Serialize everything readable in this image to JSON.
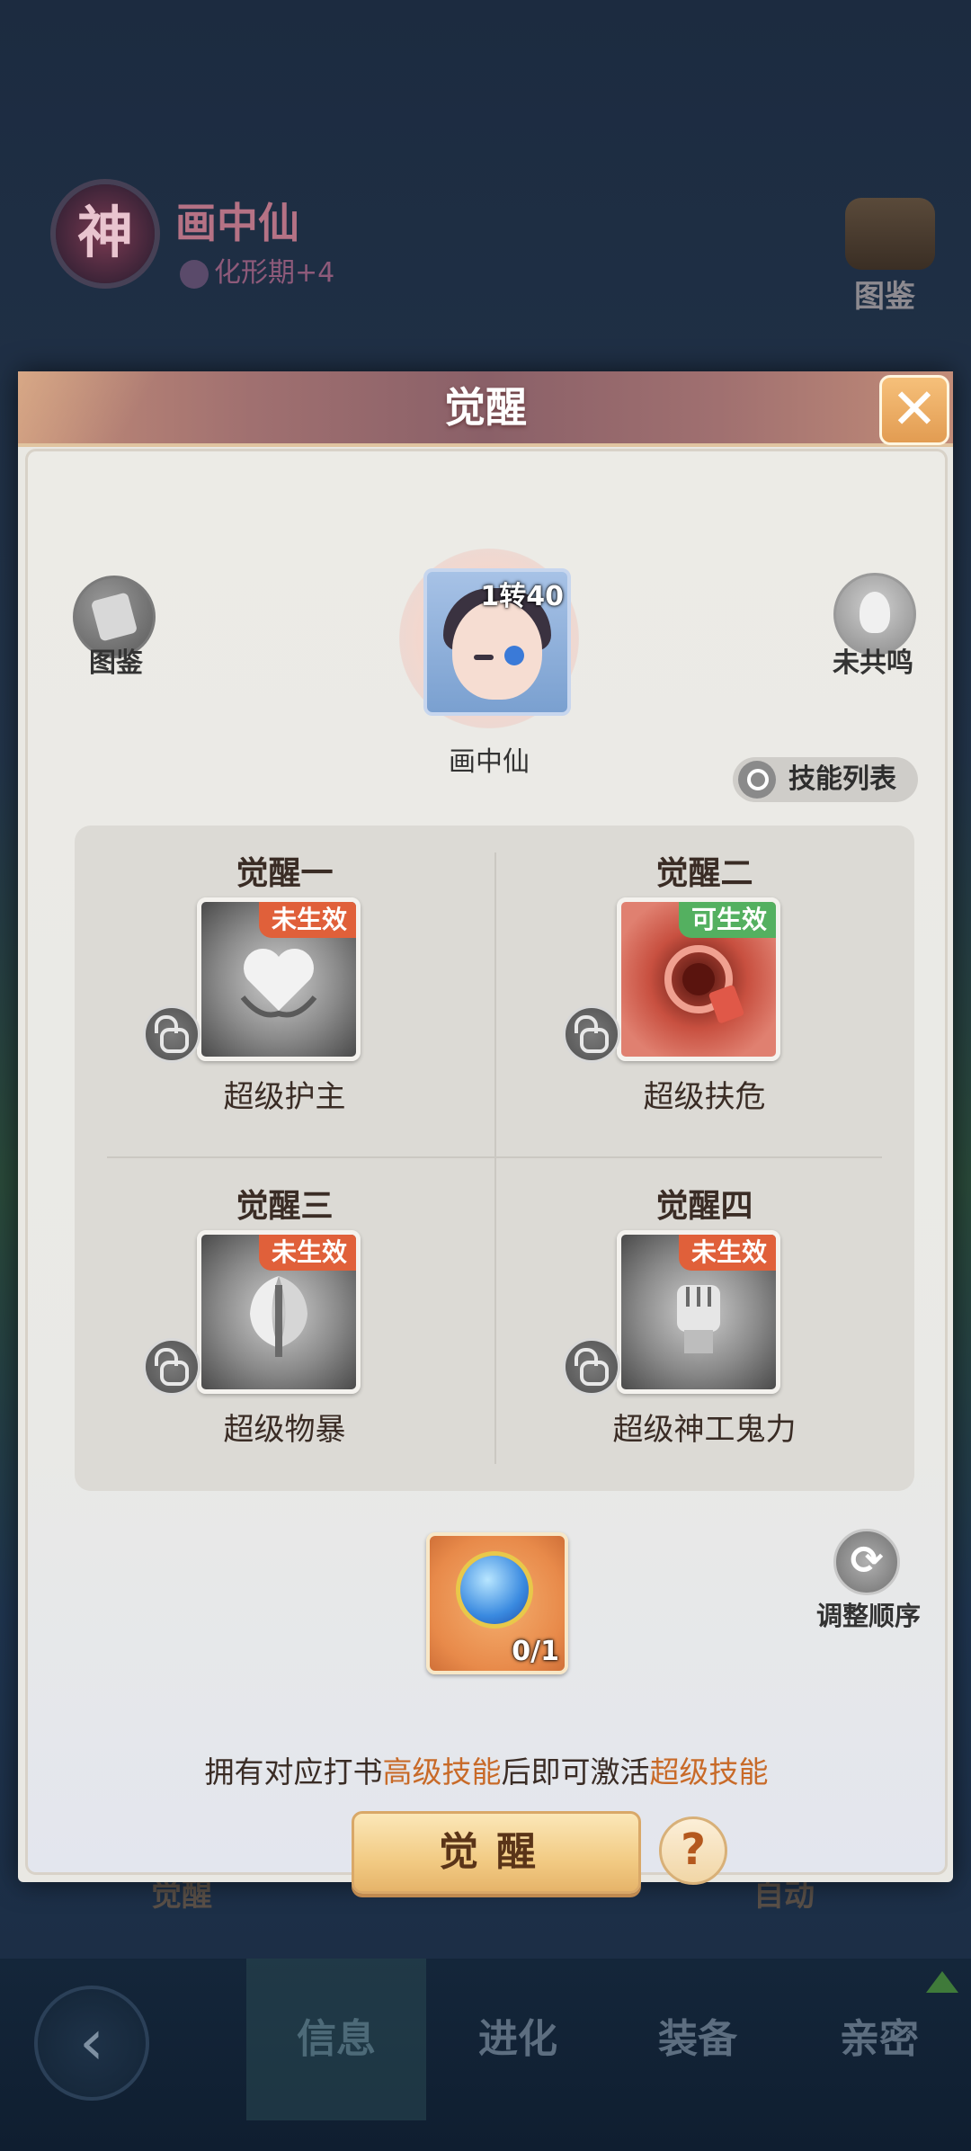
{
  "background": {
    "emblem_char": "神",
    "pet_name": "画中仙",
    "pet_stage": "化形期+4",
    "tujian_label": "图鉴",
    "bottom_label_left": "觉醒",
    "bottom_label_right": "自动"
  },
  "bottom_nav": {
    "back_icon": "‹",
    "tabs": [
      {
        "label": "信息",
        "active": true
      },
      {
        "label": "进化",
        "active": false
      },
      {
        "label": "装备",
        "active": false
      },
      {
        "label": "亲密",
        "active": false
      }
    ]
  },
  "dialog": {
    "title": "觉醒",
    "close_icon": "✕",
    "tujian_label": "图鉴",
    "resonate_label": "未共鸣",
    "pet": {
      "level": "1转40",
      "name": "画中仙"
    },
    "skill_list_label": "技能列表",
    "awakenings": [
      {
        "title": "觉醒一",
        "status": "未生效",
        "status_type": "off",
        "skill": "超级护主",
        "icon": "heart-hands-icon",
        "color": "gray"
      },
      {
        "title": "觉醒二",
        "status": "可生效",
        "status_type": "on",
        "skill": "超级扶危",
        "icon": "red-swirl-icon",
        "color": "red"
      },
      {
        "title": "觉醒三",
        "status": "未生效",
        "status_type": "off",
        "skill": "超级物暴",
        "icon": "axe-icon",
        "color": "gray"
      },
      {
        "title": "觉醒四",
        "status": "未生效",
        "status_type": "off",
        "skill": "超级神工鬼力",
        "icon": "fist-icon",
        "color": "gray"
      }
    ],
    "item": {
      "count": "0/1",
      "icon": "blue-orb-icon"
    },
    "adjust_label": "调整顺序",
    "hint": {
      "part1": "拥有对应打书",
      "highlight1": "高级技能",
      "part2": "后即可激活",
      "highlight2": "超级技能"
    },
    "awaken_button": "觉醒",
    "help_icon": "?"
  },
  "colors": {
    "status_off": "#e0603a",
    "status_on": "#54b060",
    "highlight": "#c86a28"
  }
}
